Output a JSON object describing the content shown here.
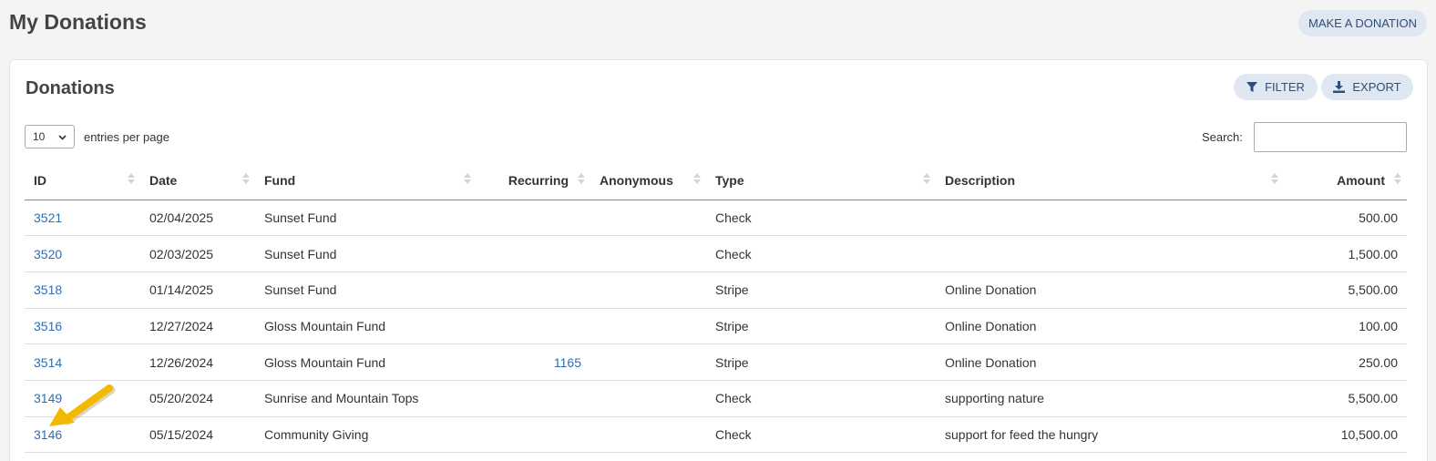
{
  "page": {
    "title": "My Donations",
    "make_donation_label": "MAKE A DONATION"
  },
  "card": {
    "title": "Donations",
    "filter_label": "FILTER",
    "export_label": "EXPORT",
    "entries_value": "10",
    "entries_label": "entries per page",
    "search_label": "Search:",
    "search_value": ""
  },
  "table": {
    "headers": {
      "id": "ID",
      "date": "Date",
      "fund": "Fund",
      "recurring": "Recurring",
      "anonymous": "Anonymous",
      "type": "Type",
      "description": "Description",
      "amount": "Amount"
    },
    "rows": [
      {
        "id": "3521",
        "date": "02/04/2025",
        "fund": "Sunset Fund",
        "recurring": "",
        "anonymous": "",
        "type": "Check",
        "description": "",
        "amount": "500.00"
      },
      {
        "id": "3520",
        "date": "02/03/2025",
        "fund": "Sunset Fund",
        "recurring": "",
        "anonymous": "",
        "type": "Check",
        "description": "",
        "amount": "1,500.00"
      },
      {
        "id": "3518",
        "date": "01/14/2025",
        "fund": "Sunset Fund",
        "recurring": "",
        "anonymous": "",
        "type": "Stripe",
        "description": "Online Donation",
        "amount": "5,500.00"
      },
      {
        "id": "3516",
        "date": "12/27/2024",
        "fund": "Gloss Mountain Fund",
        "recurring": "",
        "anonymous": "",
        "type": "Stripe",
        "description": "Online Donation",
        "amount": "100.00"
      },
      {
        "id": "3514",
        "date": "12/26/2024",
        "fund": "Gloss Mountain Fund",
        "recurring": "1165",
        "anonymous": "",
        "type": "Stripe",
        "description": "Online Donation",
        "amount": "250.00"
      },
      {
        "id": "3149",
        "date": "05/20/2024",
        "fund": "Sunrise and Mountain Tops",
        "recurring": "",
        "anonymous": "",
        "type": "Check",
        "description": "supporting nature",
        "amount": "5,500.00"
      },
      {
        "id": "3146",
        "date": "05/15/2024",
        "fund": "Community Giving",
        "recurring": "",
        "anonymous": "",
        "type": "Check",
        "description": "support for feed the hungry",
        "amount": "10,500.00"
      }
    ]
  },
  "icons": {
    "filter": "filter-icon",
    "export": "download-icon",
    "select": "chevron-down-icon",
    "annotation": "pointer-arrow-icon"
  },
  "colors": {
    "accent": "#2f6db5",
    "button_bg": "#dfe7f3",
    "button_text": "#2c4f7c",
    "annotation_arrow": "#f5b800"
  }
}
